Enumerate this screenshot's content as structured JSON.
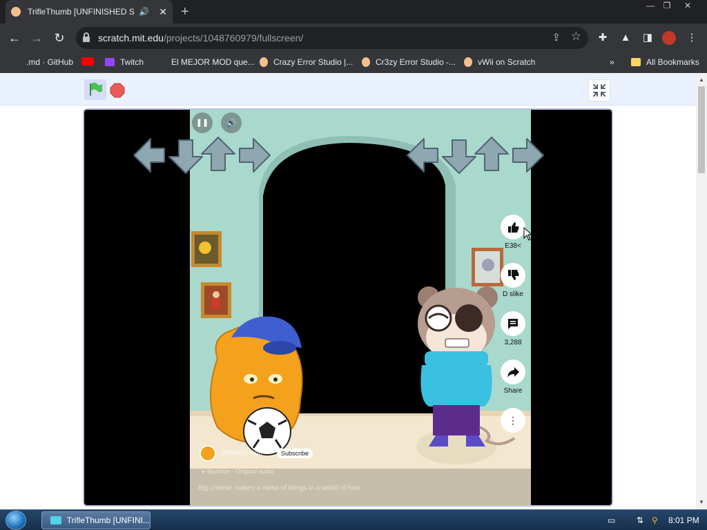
{
  "browser": {
    "tab": {
      "title": "TrifleThumb [UNFINISHED ST",
      "favicon": "scratch-cat-icon",
      "audio_icon": "speaker-icon",
      "close": "✕"
    },
    "window_controls": [
      "—",
      "❐",
      "✕"
    ],
    "address": {
      "host": "scratch.mit.edu",
      "path": "/projects/1048760979/fullscreen/"
    },
    "bookmarks": [
      {
        "label": ".md · GitHub",
        "icon": "github-icon"
      },
      {
        "label": "",
        "icon": "youtube-icon"
      },
      {
        "label": "Twitch",
        "icon": "twitch-icon"
      },
      {
        "label": "El MEJOR MOD que...",
        "icon": "link-icon"
      },
      {
        "label": "Crazy Error Studio |...",
        "icon": "scratch-icon"
      },
      {
        "label": "Cr3zy Error Studio -...",
        "icon": "scratch-icon"
      },
      {
        "label": "vWii on Scratch",
        "icon": "scratch-icon"
      }
    ],
    "bookmarks_overflow": "»",
    "all_bookmarks": "All Bookmarks"
  },
  "video": {
    "like_count": "E38<",
    "dislike_label": "D slike",
    "comment_count": "3,288",
    "share_label": "Share",
    "subscribe_label": "Subscribe",
    "channel_name": "@MeaDesign",
    "hint_line": "▸ Beatrice · Original audio",
    "caption_line": "Big cheese makes a mess of things in a world of hurt"
  },
  "taskbar": {
    "item_label": "TrifleThumb [UNFINI...",
    "clock": "8:01 PM"
  },
  "colors": {
    "stage_bg": "#a9d8cc",
    "arrow_fill": "#8ea7b1",
    "flag": "#4cbf56",
    "stop": "#ec5959"
  }
}
